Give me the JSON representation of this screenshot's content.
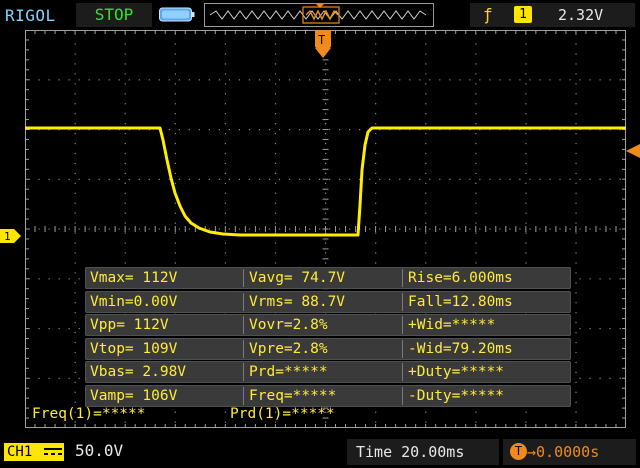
{
  "topbar": {
    "brand": "RIGOL",
    "run_state": "STOP",
    "trigger_edge_icon": "rising-edge-icon",
    "trigger_source": "1",
    "trigger_level": "2.32V",
    "colors": {
      "brand": "#7fd4ff",
      "stop": "#33e033",
      "trigger": "#ffe600"
    }
  },
  "waveform": {
    "channel_marker": "1",
    "trigger_marker": "T",
    "color": "#ffee00"
  },
  "measurements": [
    [
      "Vmax= 112V",
      "Vavg= 74.7V",
      "Rise=6.000ms"
    ],
    [
      "Vmin=0.00V",
      "Vrms= 88.7V",
      "Fall=12.80ms"
    ],
    [
      "Vpp= 112V",
      "Vovr=2.8%",
      "+Wid=*****"
    ],
    [
      "Vtop= 109V",
      "Vpre=2.8%",
      "-Wid=79.20ms"
    ],
    [
      "Vbas= 2.98V",
      "Prd=*****",
      "+Duty=*****"
    ],
    [
      "Vamp= 106V",
      "Freq=*****",
      "-Duty=*****"
    ]
  ],
  "stats": {
    "freq": "Freq(1)=*****",
    "prd": "Prd(1)=*****"
  },
  "bottombar": {
    "channel": "CH1",
    "coupling_icon": "dc-coupling-icon",
    "volts_per_div": "50.0V",
    "timebase": "Time 20.00ms",
    "offset_icon": "trigger-offset-icon",
    "offset_value": "0.0000s"
  }
}
